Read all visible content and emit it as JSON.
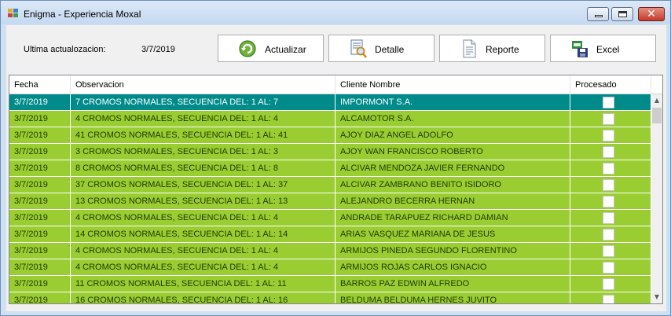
{
  "window": {
    "title": "Enigma - Experiencia Moxal",
    "close_glyph": "✕"
  },
  "toolbar": {
    "update_label": "Ultima actualozacion:",
    "update_value": "3/7/2019",
    "buttons": [
      {
        "label": "Actualizar",
        "icon": "refresh-icon"
      },
      {
        "label": "Detalle",
        "icon": "document-search-icon"
      },
      {
        "label": "Reporte",
        "icon": "report-document-icon"
      },
      {
        "label": "Excel",
        "icon": "excel-save-icon"
      }
    ]
  },
  "grid": {
    "columns": [
      "Fecha",
      "Observacion",
      "Cliente Nombre",
      "Procesado"
    ],
    "rows": [
      {
        "fecha": "3/7/2019",
        "observacion": "7 CROMOS NORMALES, SECUENCIA DEL: 1 AL: 7",
        "cliente": "IMPORMONT S.A.",
        "selected": true
      },
      {
        "fecha": "3/7/2019",
        "observacion": "4 CROMOS NORMALES, SECUENCIA DEL: 1 AL: 4",
        "cliente": "ALCAMOTOR S.A."
      },
      {
        "fecha": "3/7/2019",
        "observacion": "41 CROMOS NORMALES, SECUENCIA DEL: 1 AL: 41",
        "cliente": "AJOY DIAZ ANGEL ADOLFO"
      },
      {
        "fecha": "3/7/2019",
        "observacion": "3 CROMOS NORMALES, SECUENCIA DEL: 1 AL: 3",
        "cliente": "AJOY WAN FRANCISCO ROBERTO"
      },
      {
        "fecha": "3/7/2019",
        "observacion": "8 CROMOS NORMALES, SECUENCIA DEL: 1 AL: 8",
        "cliente": "ALCIVAR MENDOZA JAVIER FERNANDO"
      },
      {
        "fecha": "3/7/2019",
        "observacion": "37 CROMOS NORMALES, SECUENCIA DEL: 1 AL: 37",
        "cliente": "ALCIVAR ZAMBRANO BENITO ISIDORO"
      },
      {
        "fecha": "3/7/2019",
        "observacion": "13 CROMOS NORMALES, SECUENCIA DEL: 1 AL: 13",
        "cliente": "ALEJANDRO BECERRA HERNAN"
      },
      {
        "fecha": "3/7/2019",
        "observacion": "4 CROMOS NORMALES, SECUENCIA DEL: 1 AL: 4",
        "cliente": "ANDRADE TARAPUEZ RICHARD DAMIAN"
      },
      {
        "fecha": "3/7/2019",
        "observacion": "14 CROMOS NORMALES, SECUENCIA DEL: 1 AL: 14",
        "cliente": "ARIAS VASQUEZ MARIANA DE JESUS"
      },
      {
        "fecha": "3/7/2019",
        "observacion": "4 CROMOS NORMALES, SECUENCIA DEL: 1 AL: 4",
        "cliente": "ARMIJOS PINEDA SEGUNDO FLORENTINO"
      },
      {
        "fecha": "3/7/2019",
        "observacion": "4 CROMOS NORMALES, SECUENCIA DEL: 1 AL: 4",
        "cliente": "ARMIJOS ROJAS CARLOS IGNACIO"
      },
      {
        "fecha": "3/7/2019",
        "observacion": "11 CROMOS NORMALES, SECUENCIA DEL: 1 AL: 11",
        "cliente": "BARROS PAZ EDWIN ALFREDO"
      },
      {
        "fecha": "3/7/2019",
        "observacion": "16 CROMOS NORMALES, SECUENCIA DEL: 1 AL: 16",
        "cliente": "BELDUMA BELDUMA HERNES JUVITO"
      }
    ]
  },
  "scrollbar": {
    "up_glyph": "▲",
    "down_glyph": "▼"
  },
  "colors": {
    "row_bg": "#9acd32",
    "selected_bg": "#008b8b"
  }
}
